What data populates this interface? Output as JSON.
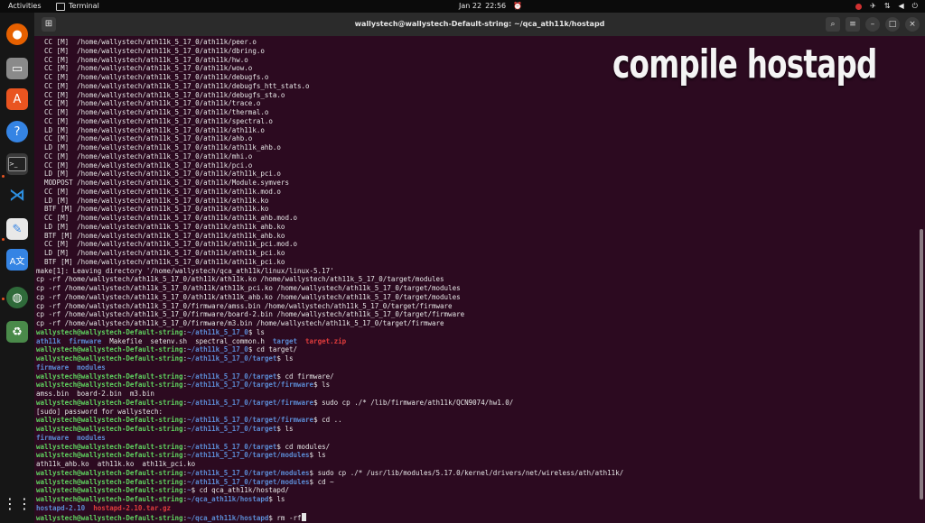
{
  "topbar": {
    "activities": "Activities",
    "app_name": "Terminal",
    "date": "Jan 22",
    "time": "22:56"
  },
  "window": {
    "title": "wallystech@wallystech-Default-string: ~/qca_ath11k/hostapd"
  },
  "overlay_title": "compile hostapd",
  "colors": {
    "prompt_user": "#5fd35f",
    "prompt_path": "#5b8bd4",
    "archive": "#e03c3c",
    "terminal_bg": "#2c0a20"
  },
  "terminal": {
    "build_lines": [
      "  CC [M]  /home/wallystech/ath11k_5_17_0/ath11k/peer.o",
      "  CC [M]  /home/wallystech/ath11k_5_17_0/ath11k/dbring.o",
      "  CC [M]  /home/wallystech/ath11k_5_17_0/ath11k/hw.o",
      "  CC [M]  /home/wallystech/ath11k_5_17_0/ath11k/wow.o",
      "  CC [M]  /home/wallystech/ath11k_5_17_0/ath11k/debugfs.o",
      "  CC [M]  /home/wallystech/ath11k_5_17_0/ath11k/debugfs_htt_stats.o",
      "  CC [M]  /home/wallystech/ath11k_5_17_0/ath11k/debugfs_sta.o",
      "  CC [M]  /home/wallystech/ath11k_5_17_0/ath11k/trace.o",
      "  CC [M]  /home/wallystech/ath11k_5_17_0/ath11k/thermal.o",
      "  CC [M]  /home/wallystech/ath11k_5_17_0/ath11k/spectral.o",
      "  LD [M]  /home/wallystech/ath11k_5_17_0/ath11k/ath11k.o",
      "  CC [M]  /home/wallystech/ath11k_5_17_0/ath11k/ahb.o",
      "  LD [M]  /home/wallystech/ath11k_5_17_0/ath11k/ath11k_ahb.o",
      "  CC [M]  /home/wallystech/ath11k_5_17_0/ath11k/mhi.o",
      "  CC [M]  /home/wallystech/ath11k_5_17_0/ath11k/pci.o",
      "  LD [M]  /home/wallystech/ath11k_5_17_0/ath11k/ath11k_pci.o",
      "  MODPOST /home/wallystech/ath11k_5_17_0/ath11k/Module.symvers",
      "  CC [M]  /home/wallystech/ath11k_5_17_0/ath11k/ath11k.mod.o",
      "  LD [M]  /home/wallystech/ath11k_5_17_0/ath11k/ath11k.ko",
      "  BTF [M] /home/wallystech/ath11k_5_17_0/ath11k/ath11k.ko",
      "  CC [M]  /home/wallystech/ath11k_5_17_0/ath11k/ath11k_ahb.mod.o",
      "  LD [M]  /home/wallystech/ath11k_5_17_0/ath11k/ath11k_ahb.ko",
      "  BTF [M] /home/wallystech/ath11k_5_17_0/ath11k/ath11k_ahb.ko",
      "  CC [M]  /home/wallystech/ath11k_5_17_0/ath11k/ath11k_pci.mod.o",
      "  LD [M]  /home/wallystech/ath11k_5_17_0/ath11k/ath11k_pci.ko",
      "  BTF [M] /home/wallystech/ath11k_5_17_0/ath11k/ath11k_pci.ko",
      "make[1]: Leaving directory '/home/wallystech/qca_ath11k/linux/linux-5.17'",
      "cp -rf /home/wallystech/ath11k_5_17_0/ath11k/ath11k.ko /home/wallystech/ath11k_5_17_0/target/modules",
      "cp -rf /home/wallystech/ath11k_5_17_0/ath11k/ath11k_pci.ko /home/wallystech/ath11k_5_17_0/target/modules",
      "cp -rf /home/wallystech/ath11k_5_17_0/ath11k/ath11k_ahb.ko /home/wallystech/ath11k_5_17_0/target/modules",
      "cp -rf /home/wallystech/ath11k_5_17_0/firmware/amss.bin /home/wallystech/ath11k_5_17_0/target/firmware",
      "cp -rf /home/wallystech/ath11k_5_17_0/firmware/board-2.bin /home/wallystech/ath11k_5_17_0/target/firmware",
      "cp -rf /home/wallystech/ath11k_5_17_0/firmware/m3.bin /home/wallystech/ath11k_5_17_0/target/firmware"
    ],
    "prompt_user": "wallystech@wallystech-Default-string",
    "session": [
      {
        "path": "~/ath11k_5_17_0",
        "cmd": "$ ls"
      },
      {
        "out_parts": [
          {
            "t": "ath11k",
            "c": "b"
          },
          {
            "t": "  ",
            "c": ""
          },
          {
            "t": "firmware",
            "c": "b"
          },
          {
            "t": "  Makefile  setenv.sh  spectral_common.h  ",
            "c": ""
          },
          {
            "t": "target",
            "c": "b"
          },
          {
            "t": "  ",
            "c": ""
          },
          {
            "t": "target.zip",
            "c": "r"
          }
        ]
      },
      {
        "path": "~/ath11k_5_17_0",
        "cmd": "$ cd target/"
      },
      {
        "path": "~/ath11k_5_17_0/target",
        "cmd": "$ ls"
      },
      {
        "out_parts": [
          {
            "t": "firmware",
            "c": "b"
          },
          {
            "t": "  ",
            "c": ""
          },
          {
            "t": "modules",
            "c": "b"
          }
        ]
      },
      {
        "path": "~/ath11k_5_17_0/target",
        "cmd": "$ cd firmware/"
      },
      {
        "path": "~/ath11k_5_17_0/target/firmware",
        "cmd": "$ ls"
      },
      {
        "out_parts": [
          {
            "t": "amss.bin  board-2.bin  m3.bin",
            "c": ""
          }
        ]
      },
      {
        "path": "~/ath11k_5_17_0/target/firmware",
        "cmd": "$ sudo cp ./* /lib/firmware/ath11k/QCN9074/hw1.0/"
      },
      {
        "out_parts": [
          {
            "t": "[sudo] password for wallystech:",
            "c": ""
          }
        ]
      },
      {
        "path": "~/ath11k_5_17_0/target/firmware",
        "cmd": "$ cd .."
      },
      {
        "path": "~/ath11k_5_17_0/target",
        "cmd": "$ ls"
      },
      {
        "out_parts": [
          {
            "t": "firmware",
            "c": "b"
          },
          {
            "t": "  ",
            "c": ""
          },
          {
            "t": "modules",
            "c": "b"
          }
        ]
      },
      {
        "path": "~/ath11k_5_17_0/target",
        "cmd": "$ cd modules/"
      },
      {
        "path": "~/ath11k_5_17_0/target/modules",
        "cmd": "$ ls"
      },
      {
        "out_parts": [
          {
            "t": "ath11k_ahb.ko  ath11k.ko  ath11k_pci.ko",
            "c": ""
          }
        ]
      },
      {
        "path": "~/ath11k_5_17_0/target/modules",
        "cmd": "$ sudo cp ./* /usr/lib/modules/5.17.0/kernel/drivers/net/wireless/ath/ath11k/"
      },
      {
        "path": "~/ath11k_5_17_0/target/modules",
        "cmd": "$ cd ~"
      },
      {
        "path": "~",
        "cmd": "$ cd qca_ath11k/hostapd/"
      },
      {
        "path": "~/qca_ath11k/hostapd",
        "cmd": "$ ls"
      },
      {
        "out_parts": [
          {
            "t": "hostapd-2.10",
            "c": "b"
          },
          {
            "t": "  ",
            "c": ""
          },
          {
            "t": "hostapd-2.10.tar.gz",
            "c": "r"
          }
        ]
      },
      {
        "path": "~/qca_ath11k/hostapd",
        "cmd": "$ rm -rf"
      }
    ]
  },
  "dock": {
    "items": [
      "firefox-icon",
      "files-icon",
      "software-center-icon",
      "help-icon",
      "terminal-icon",
      "vscode-icon",
      "text-editor-icon",
      "translate-icon",
      "globe-icon",
      "trash-icon",
      "app-grid-icon"
    ]
  }
}
